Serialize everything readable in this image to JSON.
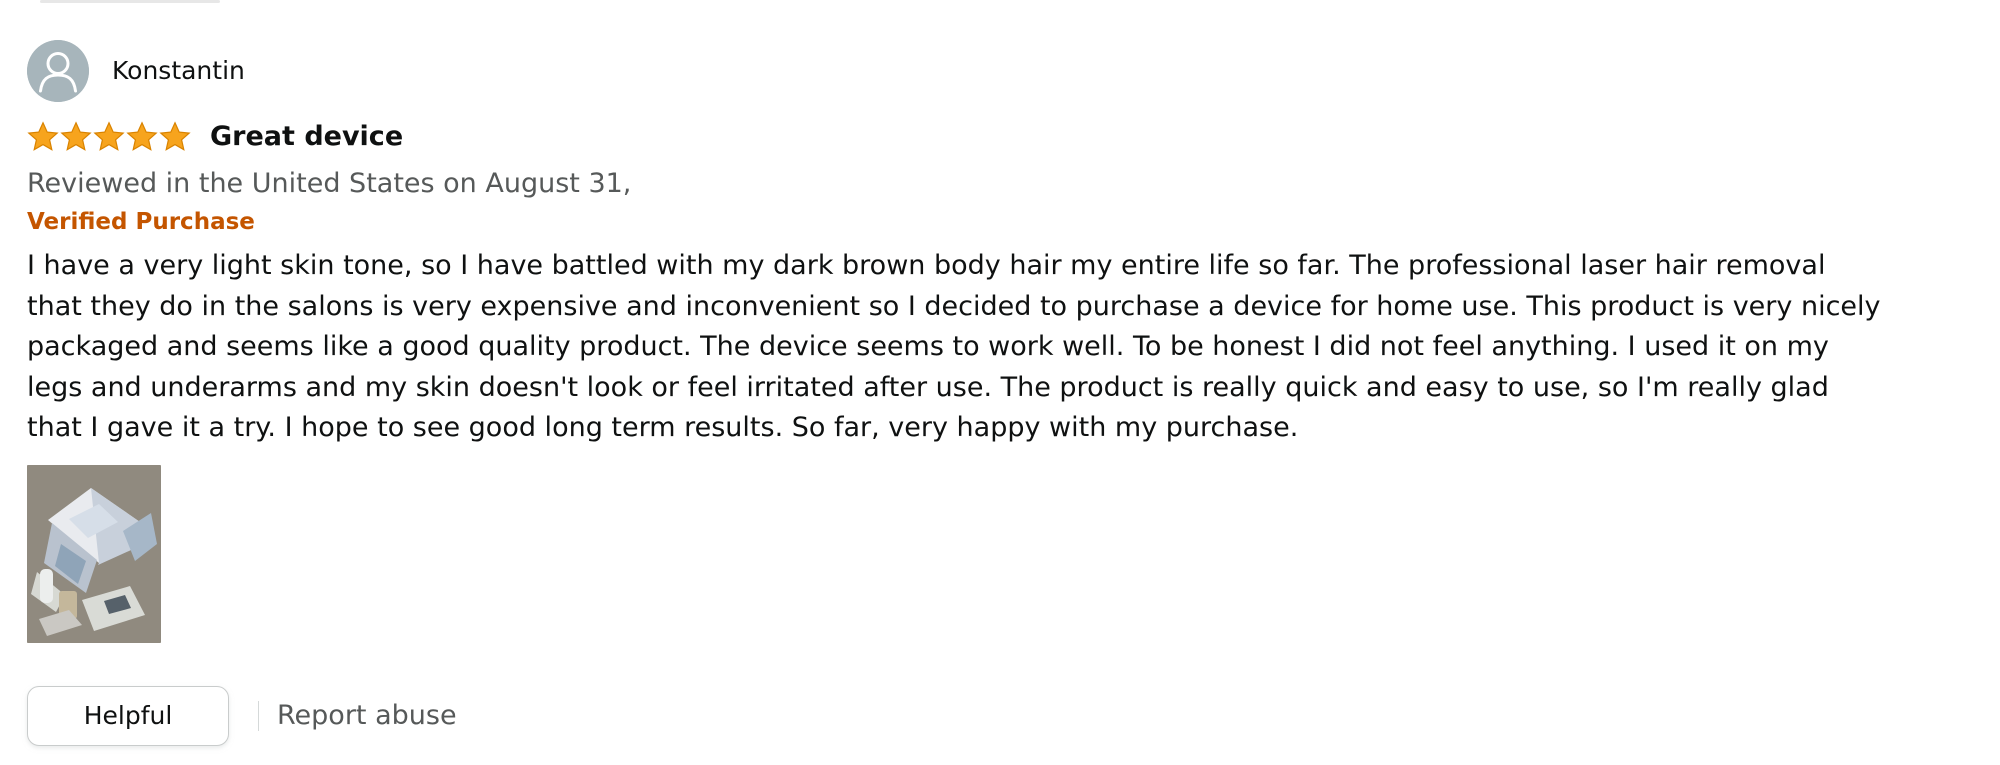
{
  "review": {
    "reviewer": {
      "name": "Konstantin",
      "avatar_icon": "default-user-icon"
    },
    "rating": {
      "value": 5,
      "max": 5,
      "star_color": "#f7a41d"
    },
    "title": "Great device",
    "date_text": "Reviewed in the United States on August 31,",
    "verified_label": "Verified Purchase",
    "verified_color": "#c45500",
    "body": "I have a very light skin tone, so I have battled with my dark brown body hair my entire life so far. The professional laser hair removal that they do in the salons is very expensive and inconvenient so I decided to purchase a device for home use. This product is very nicely packaged and seems like a good quality product. The device seems to work well. To be honest I did not feel anything. I used it on my legs and underarms and my skin doesn't look or feel irritated after use. The product is really quick and easy to use, so I'm really glad that I gave it a try. I hope to see good long term results. So far, very happy with my purchase.",
    "image": {
      "description": "review-photo-thumbnail"
    },
    "actions": {
      "helpful_label": "Helpful",
      "report_label": "Report abuse"
    }
  }
}
